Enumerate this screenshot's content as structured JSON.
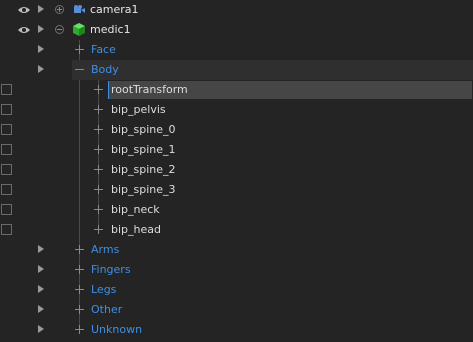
{
  "outliner": {
    "nodes": [
      {
        "label": "camera1",
        "kind": "camera",
        "visible": true
      },
      {
        "label": "medic1",
        "kind": "model",
        "visible": true
      }
    ],
    "groups": [
      {
        "label": "Face",
        "expanded": false
      },
      {
        "label": "Body",
        "expanded": true
      },
      {
        "label": "Arms",
        "expanded": false
      },
      {
        "label": "Fingers",
        "expanded": false
      },
      {
        "label": "Legs",
        "expanded": false
      },
      {
        "label": "Other",
        "expanded": false
      },
      {
        "label": "Unknown",
        "expanded": false
      }
    ],
    "body_bones": [
      {
        "label": "rootTransform",
        "selected": true
      },
      {
        "label": "bip_pelvis"
      },
      {
        "label": "bip_spine_0"
      },
      {
        "label": "bip_spine_1"
      },
      {
        "label": "bip_spine_2"
      },
      {
        "label": "bip_spine_3"
      },
      {
        "label": "bip_neck"
      },
      {
        "label": "bip_head"
      }
    ],
    "colors": {
      "background": "#242424",
      "group_text": "#3d8fe6",
      "selection": "#464646",
      "camera_icon": "#5a8ed8",
      "model_icon": "#3cc43c"
    },
    "icons": {
      "visibility": "eye-icon",
      "expand_arrow": "play-arrow-icon",
      "camera": "camera-icon",
      "model": "cube-icon"
    }
  }
}
